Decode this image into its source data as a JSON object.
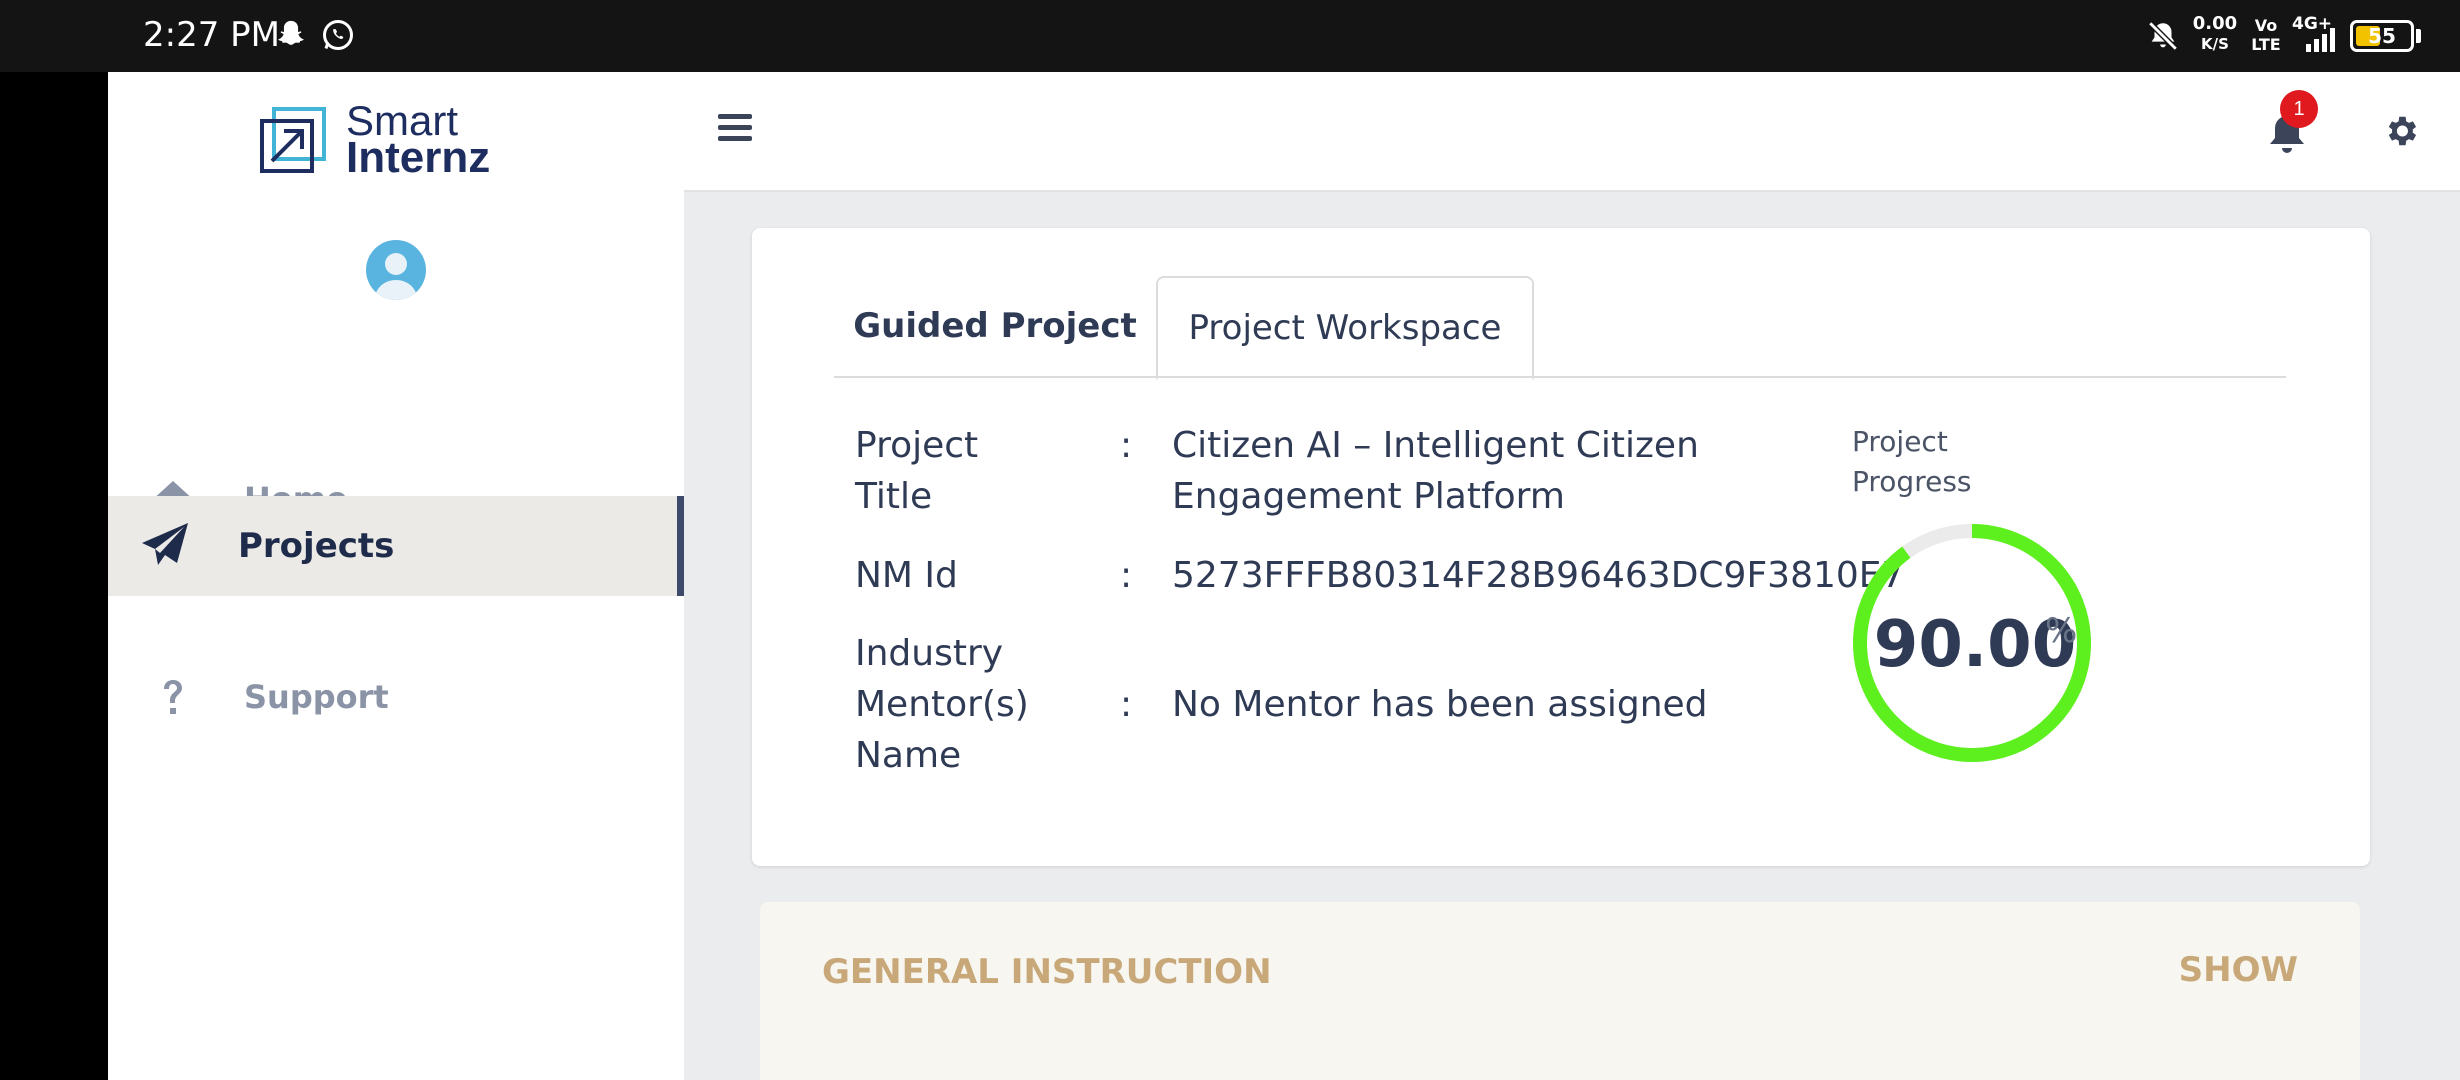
{
  "status_bar": {
    "time": "2:27 PM",
    "net_speed": "0.00",
    "net_speed_unit": "K/S",
    "volte_top": "Vo",
    "volte_bottom": "LTE",
    "network": "4G+",
    "battery": "55"
  },
  "brand": {
    "line1": "Smart",
    "line2": "Internz",
    "color": "#1e2d5f"
  },
  "sidebar": {
    "items": [
      {
        "label": "Home",
        "icon": "home-icon"
      },
      {
        "label": "Projects",
        "icon": "paper-plane-icon",
        "active": true
      },
      {
        "label": "Support",
        "icon": "question-icon"
      }
    ]
  },
  "header": {
    "notification_count": "1"
  },
  "tabs": [
    {
      "label": "Guided Project"
    },
    {
      "label": "Project Workspace",
      "active": true
    }
  ],
  "project": {
    "title_label": "Project Title",
    "title_value": "Citizen AI – Intelligent Citizen Engagement Platform",
    "nm_label": "NM Id",
    "nm_value": "5273FFFB80314F28B96463DC9F3810E7",
    "mentor_label": "Industry Mentor(s) Name",
    "mentor_value": "No Mentor has been assigned",
    "separator": ":"
  },
  "progress": {
    "label": "Project Progress",
    "value": "90.00",
    "unit": "%",
    "fraction": 0.9,
    "color": "#5ef01e"
  },
  "general_instruction": {
    "title": "GENERAL INSTRUCTION",
    "action": "SHOW"
  }
}
